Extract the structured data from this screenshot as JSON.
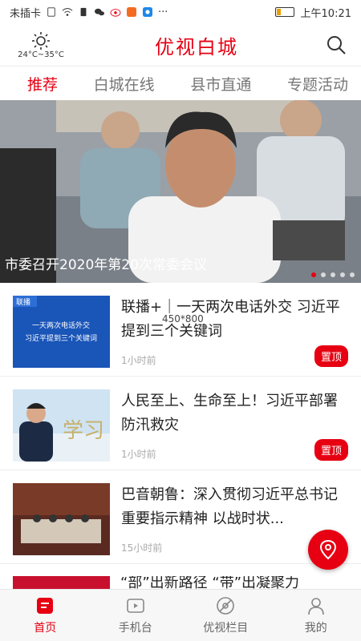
{
  "status": {
    "carrier": "未插卡",
    "time": "上午10:21",
    "icons": [
      "sim-icon",
      "wifi-icon",
      "alert-icon",
      "wechat-icon",
      "weibo-icon",
      "app-icon",
      "app-icon",
      "more-icon"
    ]
  },
  "header": {
    "weather": "24°C~35°C",
    "title": "优视白城"
  },
  "tabs": [
    {
      "label": "推荐",
      "active": true
    },
    {
      "label": "白城在线"
    },
    {
      "label": "县市直通"
    },
    {
      "label": "专题活动"
    }
  ],
  "banner": {
    "caption": "市委召开2020年第20次常委会议",
    "dots": 5
  },
  "news": [
    {
      "title": "联播+｜一天两次电话外交 习近平提到三个关键词",
      "time": "1小时前",
      "pinned": "置顶",
      "thumb_text1": "一天两次电话外交",
      "thumb_text2": "习近平提到三个关键词",
      "thumb_logo": "联播"
    },
    {
      "title": "人民至上、生命至上！习近平部署防汛救灾",
      "time": "1小时前",
      "pinned": "置顶",
      "thumb_text": "学习"
    },
    {
      "title": "巴音朝鲁：深入贯彻习近平总书记重要指示精神 以战时状...",
      "time": "15小时前"
    }
  ],
  "peek_title": "“部”出新路径 “带”出凝聚力",
  "watermark": "450*800",
  "bottom_nav": [
    {
      "label": "首页",
      "icon": "home-icon",
      "active": true
    },
    {
      "label": "手机台",
      "icon": "tv-icon"
    },
    {
      "label": "优视栏目",
      "icon": "column-icon"
    },
    {
      "label": "我的",
      "icon": "user-icon"
    }
  ],
  "colors": {
    "accent": "#e60012"
  }
}
